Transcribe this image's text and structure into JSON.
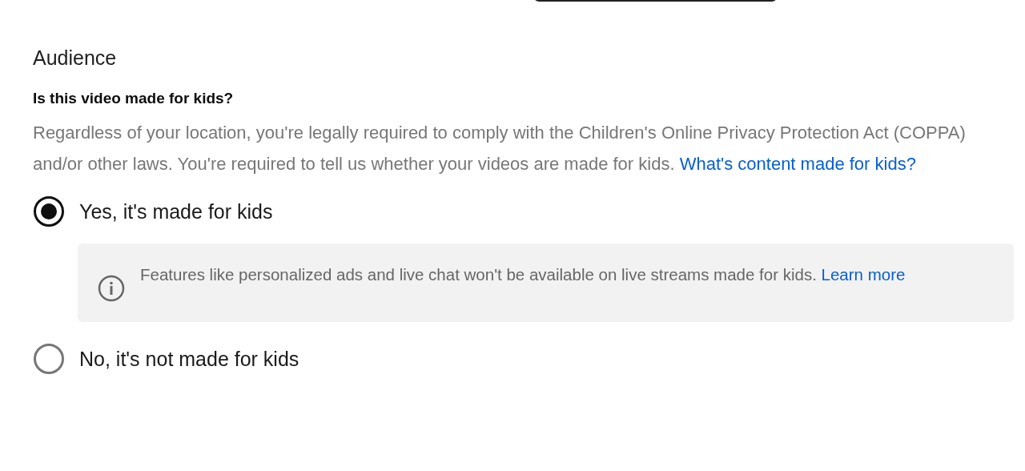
{
  "heading": "Audience",
  "question": "Is this video made for kids?",
  "description": {
    "text": "Regardless of your location, you're legally required to comply with the Children's Online Privacy Protection Act (COPPA) and/or other laws. You're required to tell us whether your videos are made for kids.",
    "link": "What's content made for kids?"
  },
  "options": [
    {
      "label": "Yes, it's made for kids",
      "selected": true,
      "note": {
        "text": "Features like personalized ads and live chat won't be available on live streams made for kids.",
        "link": "Learn more"
      }
    },
    {
      "label": "No, it's not made for kids",
      "selected": false
    }
  ]
}
